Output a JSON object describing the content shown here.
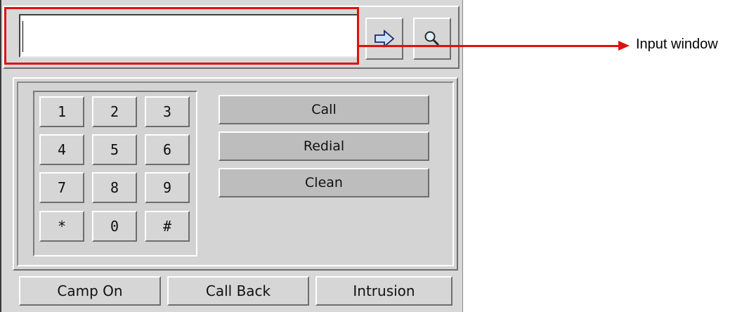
{
  "input": {
    "value": ""
  },
  "toolbar": {
    "go_icon": "arrow-right-icon",
    "search_icon": "magnifier-icon"
  },
  "keypad": {
    "keys": [
      "1",
      "2",
      "3",
      "4",
      "5",
      "6",
      "7",
      "8",
      "9",
      "*",
      "0",
      "#"
    ]
  },
  "actions": {
    "call": "Call",
    "redial": "Redial",
    "clean": "Clean"
  },
  "bottom": {
    "camp_on": "Camp On",
    "call_back": "Call Back",
    "intrusion": "Intrusion"
  },
  "annotation": {
    "label": "Input window",
    "color": "#e01010"
  }
}
